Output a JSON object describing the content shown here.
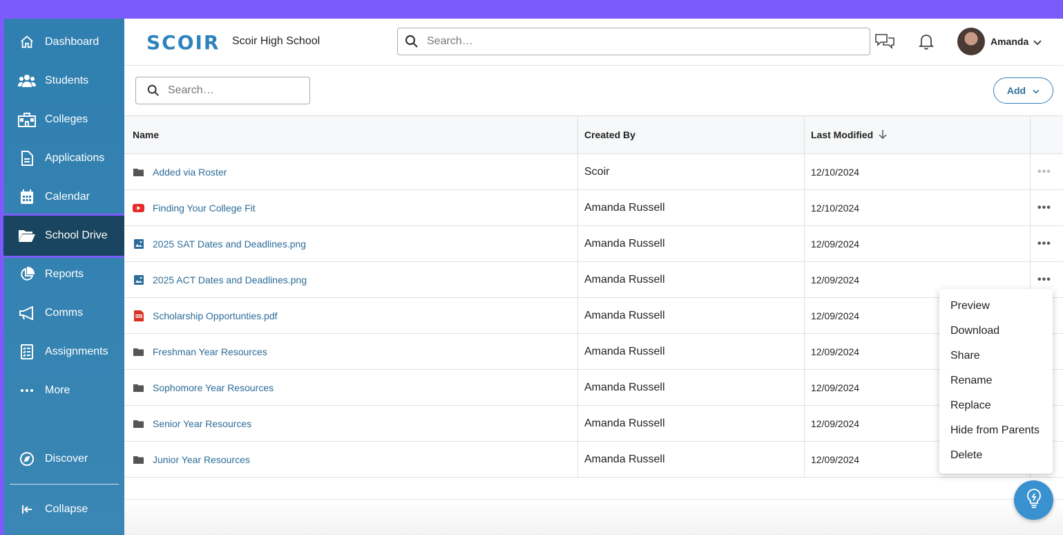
{
  "sidebar": {
    "items": [
      {
        "label": "Dashboard",
        "icon": "home-icon"
      },
      {
        "label": "Students",
        "icon": "users-icon"
      },
      {
        "label": "Colleges",
        "icon": "building-icon"
      },
      {
        "label": "Applications",
        "icon": "document-icon"
      },
      {
        "label": "Calendar",
        "icon": "calendar-icon"
      },
      {
        "label": "School Drive",
        "icon": "folder-open-icon",
        "active": true
      },
      {
        "label": "Reports",
        "icon": "pie-chart-icon"
      },
      {
        "label": "Comms",
        "icon": "megaphone-icon"
      },
      {
        "label": "Assignments",
        "icon": "checklist-icon"
      },
      {
        "label": "More",
        "icon": "more-dots-icon"
      }
    ],
    "discover": "Discover",
    "collapse": "Collapse"
  },
  "header": {
    "logo": "SCOIR",
    "school_name": "Scoir High School",
    "search_placeholder": "Search…",
    "user_name": "Amanda"
  },
  "drive": {
    "search_placeholder": "Search…",
    "add_label": "Add",
    "columns": {
      "name": "Name",
      "created_by": "Created By",
      "last_modified": "Last Modified"
    },
    "rows": [
      {
        "type": "folder",
        "name": "Added via Roster",
        "created_by": "Scoir",
        "modified": "12/10/2024"
      },
      {
        "type": "video",
        "name": "Finding Your College Fit",
        "created_by": "Amanda Russell",
        "modified": "12/10/2024"
      },
      {
        "type": "image",
        "name": "2025 SAT Dates and Deadlines.png",
        "created_by": "Amanda Russell",
        "modified": "12/09/2024"
      },
      {
        "type": "image",
        "name": "2025 ACT Dates and Deadlines.png",
        "created_by": "Amanda Russell",
        "modified": "12/09/2024"
      },
      {
        "type": "pdf",
        "name": "Scholarship Opportunties.pdf",
        "created_by": "Amanda Russell",
        "modified": "12/09/2024"
      },
      {
        "type": "folder",
        "name": "Freshman Year Resources",
        "created_by": "Amanda Russell",
        "modified": "12/09/2024"
      },
      {
        "type": "folder",
        "name": "Sophomore Year Resources",
        "created_by": "Amanda Russell",
        "modified": "12/09/2024"
      },
      {
        "type": "folder",
        "name": "Senior Year Resources",
        "created_by": "Amanda Russell",
        "modified": "12/09/2024"
      },
      {
        "type": "folder",
        "name": "Junior Year Resources",
        "created_by": "Amanda Russell",
        "modified": "12/09/2024"
      }
    ],
    "more_glyph": "•••"
  },
  "context_menu": {
    "items": [
      "Preview",
      "Download",
      "Share",
      "Rename",
      "Replace",
      "Hide from Parents",
      "Delete"
    ]
  },
  "colors": {
    "accent": "#7b5cfa",
    "sidebar": "#2f7fb0",
    "link": "#2b6c99"
  }
}
